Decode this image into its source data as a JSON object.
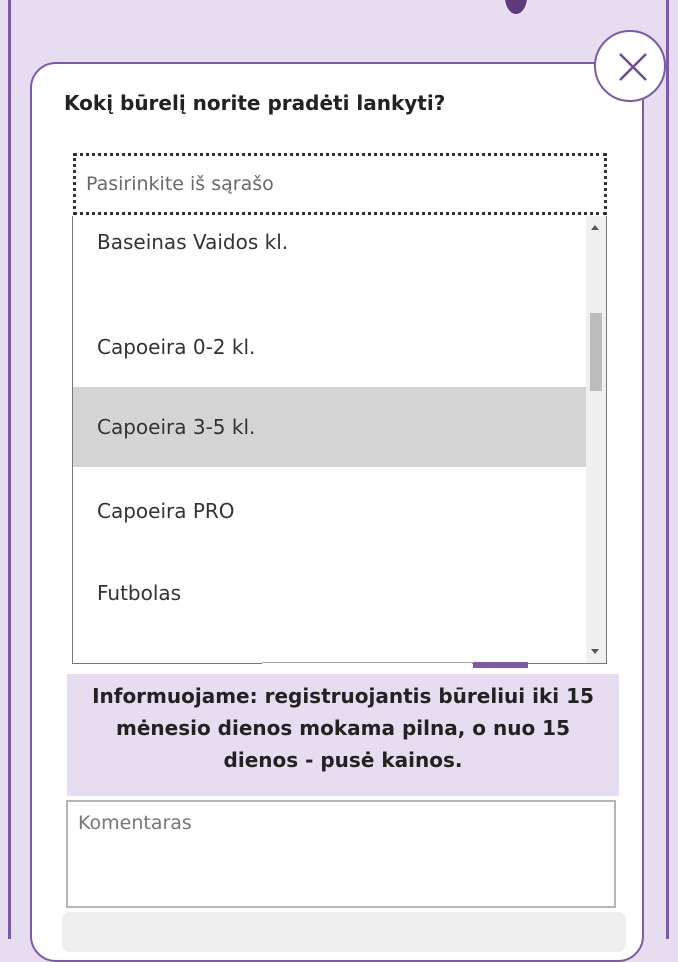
{
  "question": "Kokį būrelį norite pradėti lankyti?",
  "select": {
    "placeholder": "Pasirinkite iš sąrašo",
    "options": [
      {
        "label": "Baseinas Vaidos kl."
      },
      {
        "label": "Capoeira 0-2 kl."
      },
      {
        "label": "Capoeira 3-5 kl.",
        "selected": true
      },
      {
        "label": "Capoeira PRO"
      },
      {
        "label": "Futbolas"
      }
    ]
  },
  "info_text": "Informuojame: registruojantis būreliui iki 15 mėnesio dienos mokama pilna, o nuo 15 dienos - pusė kainos.",
  "comment": {
    "placeholder": "Komentaras",
    "value": ""
  },
  "colors": {
    "accent": "#7b5aa6",
    "background": "#e6def0",
    "selected_option": "#d4d4d4"
  },
  "icons": {
    "close": "close-icon"
  }
}
